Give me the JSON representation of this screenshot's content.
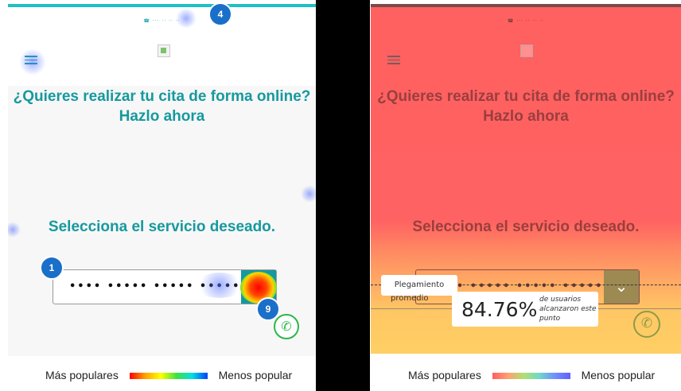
{
  "site": {
    "phone": "☎ ··· ·· ·· ··",
    "heading1": "¿Quieres realizar tu cita de forma online? Hazlo ahora",
    "heading2": "Selecciona el servicio deseado.",
    "select_value": "•••• ••••• ••••• •••••",
    "select_arrow_icon": "chevron-down-icon",
    "whatsapp_icon": "whatsapp-icon"
  },
  "heatmap": {
    "markers": [
      {
        "label": "4"
      },
      {
        "label": "1"
      },
      {
        "label": "9"
      }
    ]
  },
  "scrollmap": {
    "fold_label_line1": "Plegamiento",
    "fold_label_line2": "promedio",
    "reach_percent": "84.76%",
    "reach_desc": "de usuarios alcanzaron este punto"
  },
  "legend_left": {
    "more": "Más populares",
    "less": "Menos popular"
  },
  "legend_right": {
    "more": "Más populares",
    "less": "Menos popular"
  },
  "colors": {
    "brand_teal": "#16999e",
    "marker_blue": "#1a6fc9",
    "scroll_red": "#ff6060",
    "scroll_yellow": "#ffcf64"
  }
}
